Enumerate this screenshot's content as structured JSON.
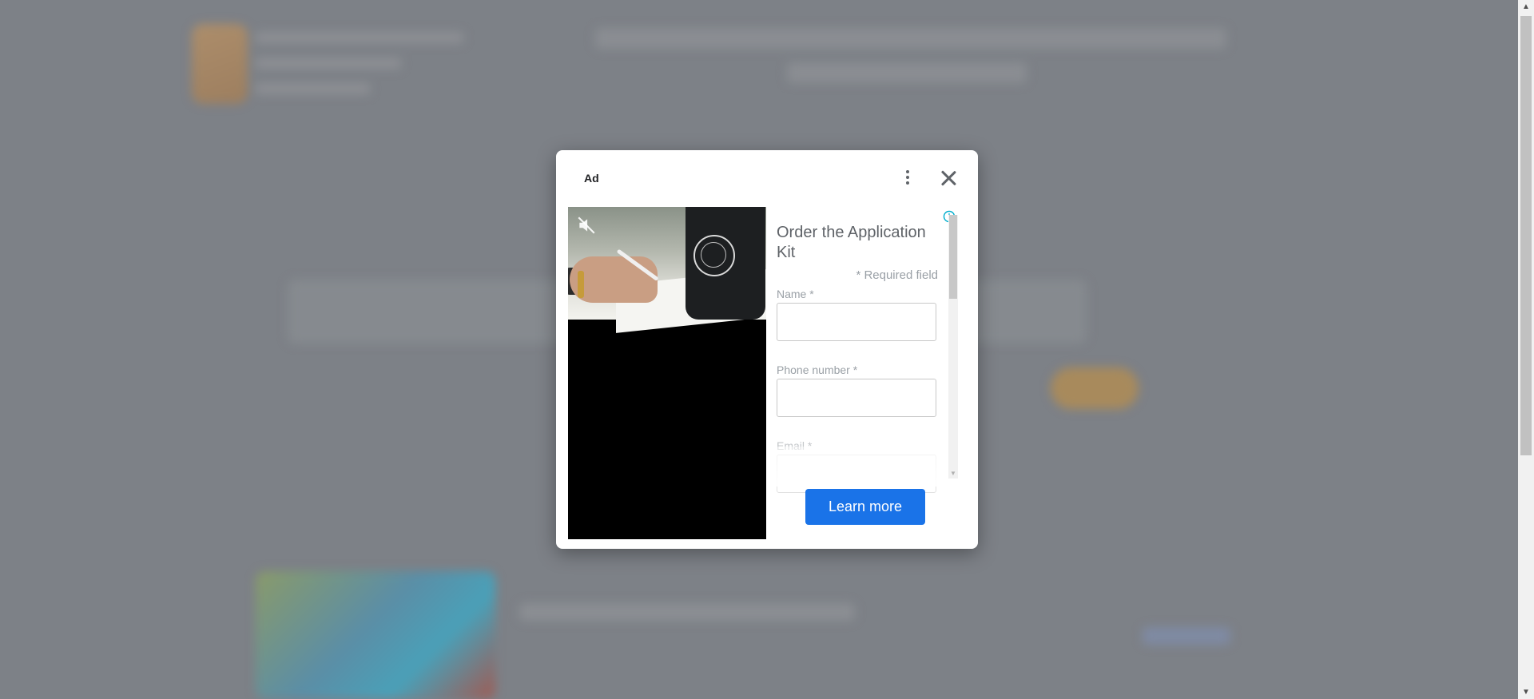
{
  "ad": {
    "label": "Ad",
    "form": {
      "title": "Order the Application Kit",
      "required_note": "* Required field",
      "fields": [
        {
          "label": "Name *",
          "value": ""
        },
        {
          "label": "Phone number *",
          "value": ""
        },
        {
          "label": "Email *",
          "value": ""
        }
      ]
    },
    "cta_label": "Learn more",
    "icons": {
      "more": "more-vert-icon",
      "close": "close-icon",
      "mute": "volume-off-icon",
      "info": "info-icon"
    },
    "colors": {
      "cta": "#1a73e8",
      "info": "#00aecd",
      "overlay": "#7d8187"
    }
  },
  "scrollbar": {
    "up_arrow": "▲",
    "down_arrow": "▼"
  }
}
